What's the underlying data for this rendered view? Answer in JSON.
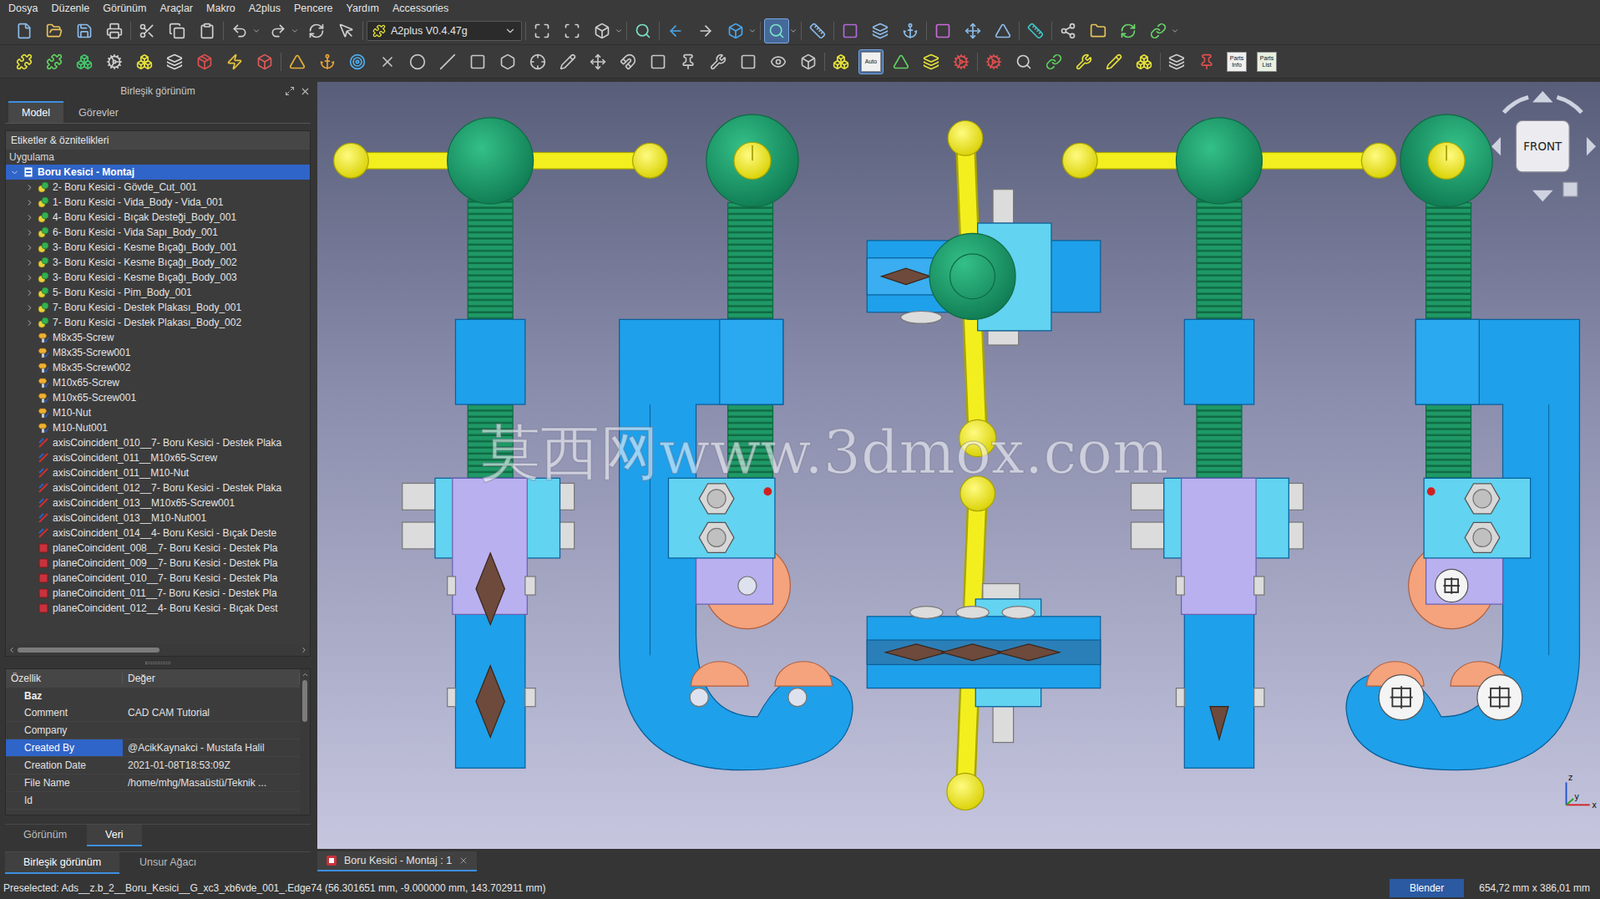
{
  "menu": [
    "Dosya",
    "Düzenle",
    "Görünüm",
    "Araçlar",
    "Makro",
    "A2plus",
    "Pencere",
    "Yardım",
    "Accessories"
  ],
  "top_toolbar": [
    [
      {
        "kind": "button",
        "selected": false,
        "menu": false
      },
      {
        "kind": "button",
        "selected": false,
        "menu": false
      },
      {
        "kind": "button",
        "selected": false,
        "menu": false
      },
      {
        "kind": "button",
        "selected": false,
        "menu": false
      }
    ],
    [
      {
        "kind": "button",
        "selected": false,
        "menu": false
      },
      {
        "kind": "button",
        "selected": false,
        "menu": false
      },
      {
        "kind": "button",
        "selected": false,
        "menu": false
      }
    ],
    [
      {
        "kind": "button",
        "selected": false,
        "menu": true
      },
      {
        "kind": "button",
        "selected": false,
        "menu": true
      },
      {
        "kind": "button",
        "selected": false,
        "menu": false
      },
      {
        "kind": "button",
        "selected": false,
        "menu": false
      }
    ],
    [
      {
        "kind": "combo",
        "label": "A2plus V0.4.47g",
        "selected": false,
        "menu": true
      }
    ],
    [
      {
        "kind": "button",
        "selected": false,
        "menu": false
      },
      {
        "kind": "button",
        "selected": false,
        "menu": false
      },
      {
        "kind": "button",
        "selected": false,
        "menu": true
      }
    ],
    [
      {
        "kind": "button",
        "selected": false,
        "menu": false
      }
    ],
    [
      {
        "kind": "button",
        "selected": false,
        "menu": false
      },
      {
        "kind": "button",
        "selected": false,
        "menu": false
      },
      {
        "kind": "button",
        "selected": false,
        "menu": true
      }
    ],
    [
      {
        "kind": "button",
        "selected": true,
        "menu": true
      }
    ],
    [
      {
        "kind": "button",
        "selected": false,
        "menu": false
      }
    ],
    [
      {
        "kind": "button",
        "selected": false,
        "menu": false
      },
      {
        "kind": "button",
        "selected": false,
        "menu": false
      },
      {
        "kind": "button",
        "selected": false,
        "menu": false
      }
    ],
    [
      {
        "kind": "button",
        "selected": false,
        "menu": false
      },
      {
        "kind": "button",
        "selected": false,
        "menu": false
      },
      {
        "kind": "button",
        "selected": false,
        "menu": false
      }
    ],
    [
      {
        "kind": "button",
        "selected": false,
        "menu": false
      }
    ],
    [
      {
        "kind": "button",
        "selected": false,
        "menu": false
      },
      {
        "kind": "button",
        "selected": false,
        "menu": false
      },
      {
        "kind": "button",
        "selected": false,
        "menu": false
      },
      {
        "kind": "button",
        "selected": false,
        "menu": true
      }
    ]
  ],
  "bottom_toolbar": [
    [
      {
        "selected": false
      },
      {
        "selected": false
      },
      {
        "selected": false
      },
      {
        "selected": false
      },
      {
        "selected": false
      },
      {
        "selected": false
      },
      {
        "selected": false
      },
      {
        "selected": false
      },
      {
        "selected": false
      }
    ],
    [
      {
        "selected": false
      },
      {
        "selected": false
      },
      {
        "selected": false
      },
      {
        "selected": false
      },
      {
        "selected": false
      },
      {
        "selected": false
      },
      {
        "selected": false
      },
      {
        "selected": false
      },
      {
        "selected": false
      },
      {
        "selected": false
      },
      {
        "selected": false
      },
      {
        "selected": false
      },
      {
        "selected": false
      },
      {
        "selected": false
      },
      {
        "selected": false
      },
      {
        "selected": false
      },
      {
        "selected": false
      },
      {
        "selected": false
      }
    ],
    [
      {
        "selected": false
      },
      {
        "selected": true,
        "label": "Auto"
      },
      {
        "selected": false
      },
      {
        "selected": false
      },
      {
        "selected": false
      }
    ],
    [
      {
        "selected": false
      },
      {
        "selected": false
      },
      {
        "selected": false
      },
      {
        "selected": false
      },
      {
        "selected": false
      },
      {
        "selected": false
      }
    ],
    [
      {
        "selected": false
      },
      {
        "selected": false
      },
      {
        "selected": false,
        "label": "Parts Info"
      },
      {
        "selected": false,
        "label": "Parts List"
      }
    ]
  ],
  "combo_view": {
    "title": "Birleşik görünüm",
    "tabs": [
      {
        "label": "Model",
        "selected": true
      },
      {
        "label": "Görevler",
        "selected": false
      }
    ],
    "tree_header": "Etiketler & öznitelikleri",
    "tree_root": "Uygulama",
    "tree": [
      {
        "label": "Boru Kesici - Montaj",
        "level": 0,
        "kind": "document",
        "expandable": true,
        "expanded": true,
        "selected": true
      },
      {
        "label": "2- Boru Kesici - Gövde_Cut_001",
        "level": 1,
        "kind": "part",
        "expandable": true,
        "expanded": false,
        "selected": false
      },
      {
        "label": "1- Boru Kesici - Vida_Body - Vida_001",
        "level": 1,
        "kind": "part",
        "expandable": true,
        "expanded": false,
        "selected": false
      },
      {
        "label": "4- Boru Kesici - Bıçak Desteği_Body_001",
        "level": 1,
        "kind": "part",
        "expandable": true,
        "expanded": false,
        "selected": false
      },
      {
        "label": "6- Boru Kesici - Vida Sapı_Body_001",
        "level": 1,
        "kind": "part",
        "expandable": true,
        "expanded": false,
        "selected": false
      },
      {
        "label": "3- Boru Kesici - Kesme Bıçağı_Body_001",
        "level": 1,
        "kind": "part",
        "expandable": true,
        "expanded": false,
        "selected": false
      },
      {
        "label": "3- Boru Kesici - Kesme Bıçağı_Body_002",
        "level": 1,
        "kind": "part",
        "expandable": true,
        "expanded": false,
        "selected": false
      },
      {
        "label": "3- Boru Kesici - Kesme Bıçağı_Body_003",
        "level": 1,
        "kind": "part",
        "expandable": true,
        "expanded": false,
        "selected": false
      },
      {
        "label": "5- Boru Kesici - Pim_Body_001",
        "level": 1,
        "kind": "part",
        "expandable": true,
        "expanded": false,
        "selected": false
      },
      {
        "label": "7- Boru Kesici - Destek Plakası_Body_001",
        "level": 1,
        "kind": "part",
        "expandable": true,
        "expanded": false,
        "selected": false
      },
      {
        "label": "7- Boru Kesici - Destek Plakası_Body_002",
        "level": 1,
        "kind": "part",
        "expandable": true,
        "expanded": false,
        "selected": false
      },
      {
        "label": "M8x35-Screw",
        "level": 1,
        "kind": "fastener",
        "expandable": false,
        "expanded": false,
        "selected": false
      },
      {
        "label": "M8x35-Screw001",
        "level": 1,
        "kind": "fastener",
        "expandable": false,
        "expanded": false,
        "selected": false
      },
      {
        "label": "M8x35-Screw002",
        "level": 1,
        "kind": "fastener",
        "expandable": false,
        "expanded": false,
        "selected": false
      },
      {
        "label": "M10x65-Screw",
        "level": 1,
        "kind": "fastener",
        "expandable": false,
        "expanded": false,
        "selected": false
      },
      {
        "label": "M10x65-Screw001",
        "level": 1,
        "kind": "fastener",
        "expandable": false,
        "expanded": false,
        "selected": false
      },
      {
        "label": "M10-Nut",
        "level": 1,
        "kind": "fastener",
        "expandable": false,
        "expanded": false,
        "selected": false
      },
      {
        "label": "M10-Nut001",
        "level": 1,
        "kind": "fastener",
        "expandable": false,
        "expanded": false,
        "selected": false
      },
      {
        "label": "axisCoincident_010__7- Boru Kesici - Destek Plaka",
        "level": 1,
        "kind": "axis",
        "expandable": false,
        "expanded": false,
        "selected": false
      },
      {
        "label": "axisCoincident_011__M10x65-Screw",
        "level": 1,
        "kind": "axis",
        "expandable": false,
        "expanded": false,
        "selected": false
      },
      {
        "label": "axisCoincident_011__M10-Nut",
        "level": 1,
        "kind": "axis",
        "expandable": false,
        "expanded": false,
        "selected": false
      },
      {
        "label": "axisCoincident_012__7- Boru Kesici - Destek Plaka",
        "level": 1,
        "kind": "axis",
        "expandable": false,
        "expanded": false,
        "selected": false
      },
      {
        "label": "axisCoincident_013__M10x65-Screw001",
        "level": 1,
        "kind": "axis",
        "expandable": false,
        "expanded": false,
        "selected": false
      },
      {
        "label": "axisCoincident_013__M10-Nut001",
        "level": 1,
        "kind": "axis",
        "expandable": false,
        "expanded": false,
        "selected": false
      },
      {
        "label": "axisCoincident_014__4- Boru Kesici - Bıçak Deste",
        "level": 1,
        "kind": "axis",
        "expandable": false,
        "expanded": false,
        "selected": false
      },
      {
        "label": "planeCoincident_008__7- Boru Kesici - Destek Pla",
        "level": 1,
        "kind": "plane",
        "expandable": false,
        "expanded": false,
        "selected": false
      },
      {
        "label": "planeCoincident_009__7- Boru Kesici - Destek Pla",
        "level": 1,
        "kind": "plane",
        "expandable": false,
        "expanded": false,
        "selected": false
      },
      {
        "label": "planeCoincident_010__7- Boru Kesici - Destek Pla",
        "level": 1,
        "kind": "plane",
        "expandable": false,
        "expanded": false,
        "selected": false
      },
      {
        "label": "planeCoincident_011__7- Boru Kesici - Destek Pla",
        "level": 1,
        "kind": "plane",
        "expandable": false,
        "expanded": false,
        "selected": false
      },
      {
        "label": "planeCoincident_012__4- Boru Kesici - Bıçak Dest",
        "level": 1,
        "kind": "plane",
        "expandable": false,
        "expanded": false,
        "selected": false
      }
    ]
  },
  "properties": {
    "columns": [
      "Özellik",
      "Değer"
    ],
    "group": "Baz",
    "rows": [
      {
        "name": "Comment",
        "value": "CAD CAM Tutorial",
        "selected": false
      },
      {
        "name": "Company",
        "value": "",
        "selected": false
      },
      {
        "name": "Created By",
        "value": "@AcikKaynakci - Mustafa Halil",
        "selected": true
      },
      {
        "name": "Creation Date",
        "value": "2021-01-08T18:53:09Z",
        "selected": false
      },
      {
        "name": "File Name",
        "value": "/home/mhg/Masaüstü/Teknik ...",
        "selected": false
      },
      {
        "name": "Id",
        "value": "",
        "selected": false
      }
    ],
    "tabs": [
      {
        "label": "Görünüm",
        "selected": false
      },
      {
        "label": "Veri",
        "selected": true
      }
    ]
  },
  "dock_tabs": [
    {
      "label": "Birleşik görünüm",
      "selected": true
    },
    {
      "label": "Unsur Ağacı",
      "selected": false
    }
  ],
  "viewport": {
    "watermark": "莫西网www.3dmox.com",
    "nav_cube": "FRONT",
    "axes": [
      "z",
      "y",
      "x"
    ]
  },
  "document_tabs": [
    {
      "label": "Boru Kesici - Montaj : 1",
      "selected": true
    }
  ],
  "status_bar": {
    "message": "Preselected: Ads__z.b_2__Boru_Kesici__G_xc3_xb6vde_001_.Edge74 (56.301651 mm, -9.000000 mm, 143.702911 mm)",
    "navigation": "Blender",
    "dimensions": "654,72 mm x 386,01 mm"
  }
}
